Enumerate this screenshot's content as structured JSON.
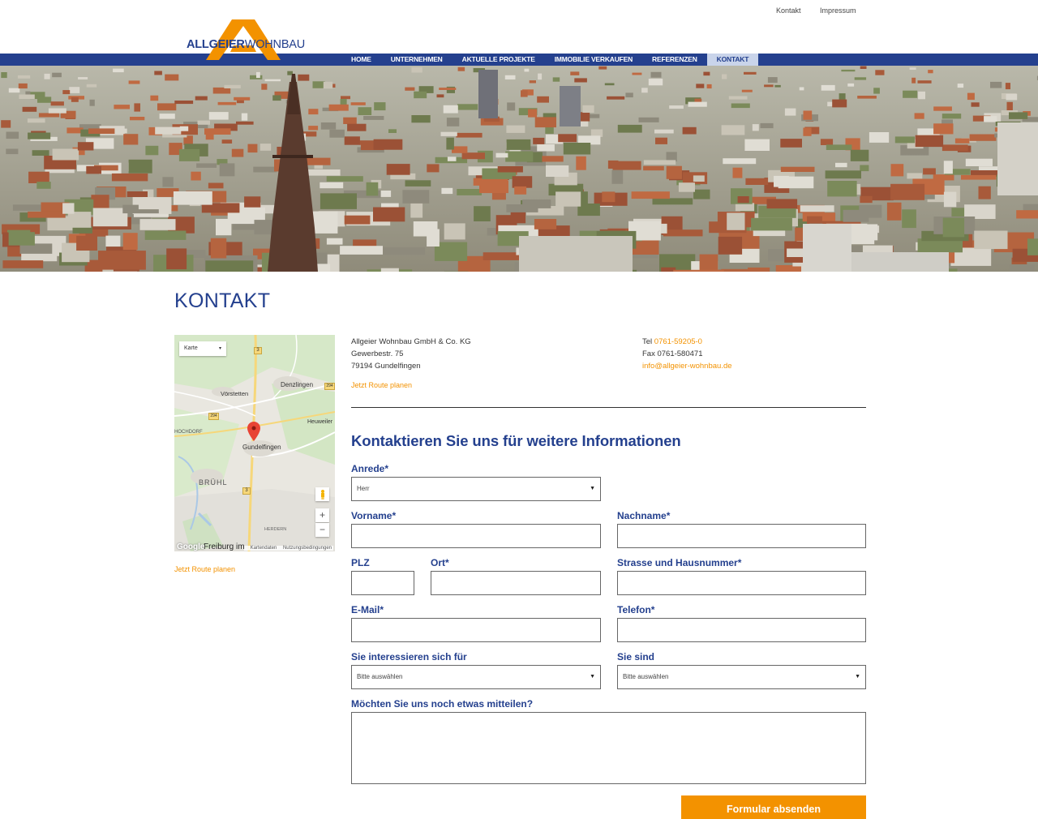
{
  "toplinks": {
    "kontakt": "Kontakt",
    "impressum": "Impressum"
  },
  "logo": {
    "part1": "ALLGEIER",
    "part2": "WOHNBAU"
  },
  "nav": {
    "home": "HOME",
    "unternehmen": "UNTERNEHMEN",
    "projekte": "AKTUELLE PROJEKTE",
    "verkaufen": "IMMOBILIE VERKAUFEN",
    "referenzen": "REFERENZEN",
    "kontakt": "KONTAKT"
  },
  "page": {
    "title": "KONTAKT"
  },
  "map": {
    "type_label": "Karte",
    "labels": {
      "denzlingen": "Denzlingen",
      "vorstetten": "Vörstetten",
      "heuweiler": "Heuweiler",
      "hochdorf": "HOCHDORF",
      "gundelfingen": "Gundelfingen",
      "bruehl": "BRÜHL",
      "herdern": "HERDERN",
      "freiburg": "Freiburg im"
    },
    "road_badges": {
      "r3a": "3",
      "r294a": "294",
      "r294b": "294",
      "r3b": "3"
    },
    "google": "Google",
    "kartendaten": "Kartendaten",
    "nutzung": "Nutzungsbedingungen",
    "zoom_in": "+",
    "zoom_out": "−"
  },
  "route_link_left": "Jetzt Route planen",
  "address": {
    "company": "Allgeier Wohnbau GmbH & Co. KG",
    "street": "Gewerbestr. 75",
    "city": "79194 Gundelfingen",
    "route_link": "Jetzt Route planen"
  },
  "contact": {
    "tel_label": "Tel",
    "tel": "0761-59205-0",
    "fax": "Fax 0761-580471",
    "email": "info@allgeier-wohnbau.de"
  },
  "form": {
    "title": "Kontaktieren Sie uns für weitere Informationen",
    "anrede_label": "Anrede*",
    "anrede_value": "Herr",
    "vorname_label": "Vorname*",
    "nachname_label": "Nachname*",
    "plz_label": "PLZ",
    "ort_label": "Ort*",
    "strasse_label": "Strasse und Hausnummer*",
    "email_label": "E-Mail*",
    "telefon_label": "Telefon*",
    "interesse_label": "Sie interessieren sich für",
    "interesse_value": "Bitte auswählen",
    "sind_label": "Sie sind",
    "sind_value": "Bitte auswählen",
    "message_label": "Möchten Sie uns noch etwas mitteilen?",
    "submit": "Formular absenden"
  },
  "colors": {
    "brand_blue": "#24408e",
    "accent_orange": "#f39200",
    "nav_active": "#c9d4ea"
  }
}
